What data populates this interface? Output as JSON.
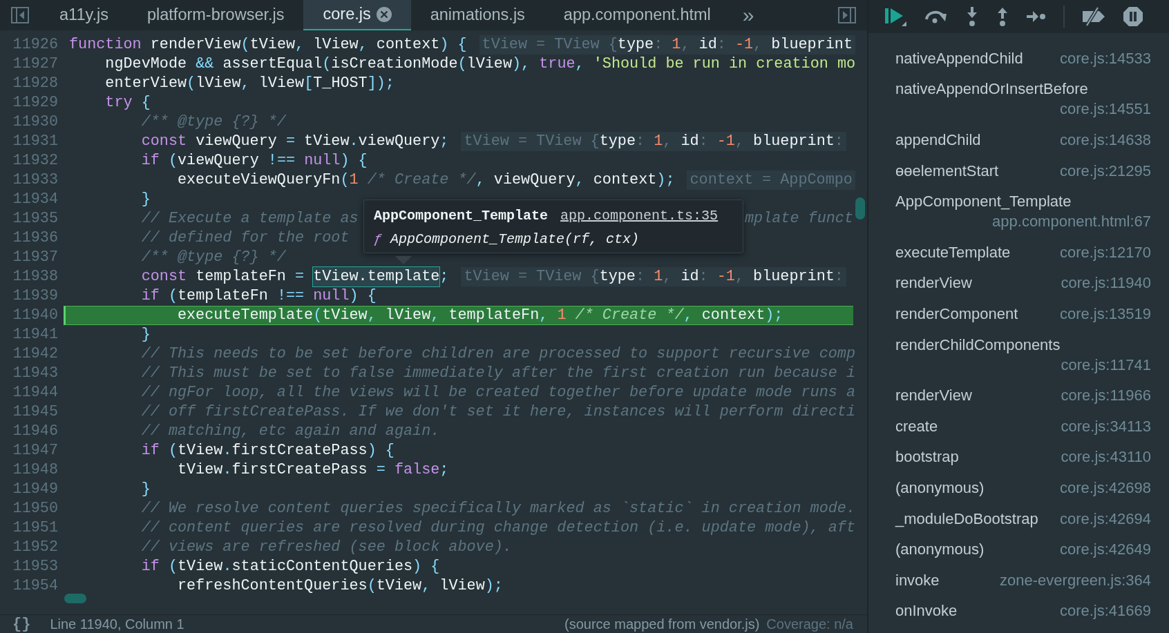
{
  "tabs": [
    {
      "label": "a11y.js",
      "selected": false
    },
    {
      "label": "platform-browser.js",
      "selected": false
    },
    {
      "label": "core.js",
      "selected": true
    },
    {
      "label": "animations.js",
      "selected": false
    },
    {
      "label": "app.component.html",
      "selected": false
    }
  ],
  "more_tabs": "»",
  "lines": [
    {
      "number": "11926",
      "paused": false,
      "tokens": [
        {
          "kind": "k",
          "text": "function "
        },
        {
          "kind": "p",
          "text": "renderView"
        },
        {
          "kind": "o",
          "text": "("
        },
        {
          "kind": "p",
          "text": "tView"
        },
        {
          "kind": "o",
          "text": ", "
        },
        {
          "kind": "p",
          "text": "lView"
        },
        {
          "kind": "o",
          "text": ", "
        },
        {
          "kind": "p",
          "text": "context"
        },
        {
          "kind": "o",
          "text": ") {"
        }
      ],
      "hint": [
        {
          "kind": "h",
          "text": "tView = TView {"
        },
        {
          "kind": "p",
          "text": "type"
        },
        {
          "kind": "h",
          "text": ": "
        },
        {
          "kind": "n",
          "text": "1"
        },
        {
          "kind": "h",
          "text": ", "
        },
        {
          "kind": "p",
          "text": "id"
        },
        {
          "kind": "h",
          "text": ": "
        },
        {
          "kind": "n",
          "text": "-1"
        },
        {
          "kind": "h",
          "text": ", "
        },
        {
          "kind": "p",
          "text": "blueprint"
        }
      ]
    },
    {
      "number": "11927",
      "paused": false,
      "tokens": [
        {
          "kind": "p",
          "text": "    ngDevMode "
        },
        {
          "kind": "o",
          "text": "&& "
        },
        {
          "kind": "p",
          "text": "assertEqual"
        },
        {
          "kind": "o",
          "text": "("
        },
        {
          "kind": "p",
          "text": "isCreationMode"
        },
        {
          "kind": "o",
          "text": "("
        },
        {
          "kind": "p",
          "text": "lView"
        },
        {
          "kind": "o",
          "text": "), "
        },
        {
          "kind": "k",
          "text": "true"
        },
        {
          "kind": "o",
          "text": ", "
        },
        {
          "kind": "s",
          "text": "'Should be run in creation mo"
        }
      ]
    },
    {
      "number": "11928",
      "paused": false,
      "tokens": [
        {
          "kind": "p",
          "text": "    enterView"
        },
        {
          "kind": "o",
          "text": "("
        },
        {
          "kind": "p",
          "text": "lView"
        },
        {
          "kind": "o",
          "text": ", "
        },
        {
          "kind": "p",
          "text": "lView"
        },
        {
          "kind": "o",
          "text": "["
        },
        {
          "kind": "p",
          "text": "T_HOST"
        },
        {
          "kind": "o",
          "text": "]);"
        }
      ]
    },
    {
      "number": "11929",
      "paused": false,
      "tokens": [
        {
          "kind": "k",
          "text": "    try "
        },
        {
          "kind": "o",
          "text": "{"
        }
      ]
    },
    {
      "number": "11930",
      "paused": false,
      "tokens": [
        {
          "kind": "c",
          "text": "        /** @type {?} */"
        }
      ]
    },
    {
      "number": "11931",
      "paused": false,
      "tokens": [
        {
          "kind": "k",
          "text": "        const "
        },
        {
          "kind": "p",
          "text": "viewQuery "
        },
        {
          "kind": "o",
          "text": "= "
        },
        {
          "kind": "p",
          "text": "tView"
        },
        {
          "kind": "o",
          "text": "."
        },
        {
          "kind": "p",
          "text": "viewQuery"
        },
        {
          "kind": "o",
          "text": ";"
        }
      ],
      "hint": [
        {
          "kind": "h",
          "text": "tView = TView {"
        },
        {
          "kind": "p",
          "text": "type"
        },
        {
          "kind": "h",
          "text": ": "
        },
        {
          "kind": "n",
          "text": "1"
        },
        {
          "kind": "h",
          "text": ", "
        },
        {
          "kind": "p",
          "text": "id"
        },
        {
          "kind": "h",
          "text": ": "
        },
        {
          "kind": "n",
          "text": "-1"
        },
        {
          "kind": "h",
          "text": ", "
        },
        {
          "kind": "p",
          "text": "blueprint"
        },
        {
          "kind": "h",
          "text": ":"
        }
      ]
    },
    {
      "number": "11932",
      "paused": false,
      "tokens": [
        {
          "kind": "k",
          "text": "        if "
        },
        {
          "kind": "o",
          "text": "("
        },
        {
          "kind": "p",
          "text": "viewQuery "
        },
        {
          "kind": "o",
          "text": "!== "
        },
        {
          "kind": "k",
          "text": "null"
        },
        {
          "kind": "o",
          "text": ") {"
        }
      ]
    },
    {
      "number": "11933",
      "paused": false,
      "tokens": [
        {
          "kind": "p",
          "text": "            executeViewQueryFn"
        },
        {
          "kind": "o",
          "text": "("
        },
        {
          "kind": "n",
          "text": "1 "
        },
        {
          "kind": "c",
          "text": "/* Create */"
        },
        {
          "kind": "o",
          "text": ", "
        },
        {
          "kind": "p",
          "text": "viewQuery"
        },
        {
          "kind": "o",
          "text": ", "
        },
        {
          "kind": "p",
          "text": "context"
        },
        {
          "kind": "o",
          "text": ");"
        }
      ],
      "hint": [
        {
          "kind": "h",
          "text": "context = AppCompo"
        }
      ]
    },
    {
      "number": "11934",
      "paused": false,
      "tokens": [
        {
          "kind": "o",
          "text": "        }"
        }
      ]
    },
    {
      "number": "11935",
      "paused": false,
      "tokens": [
        {
          "kind": "c",
          "text": "        // Execute a template as"
        },
        {
          "kind": "tail",
          "text": "mplate funct"
        }
      ]
    },
    {
      "number": "11936",
      "paused": false,
      "tokens": [
        {
          "kind": "c",
          "text": "        // defined for the root"
        }
      ]
    },
    {
      "number": "11937",
      "paused": false,
      "tokens": [
        {
          "kind": "c",
          "text": "        /** @type {?} */"
        }
      ]
    },
    {
      "number": "11938",
      "paused": false,
      "tokens": [
        {
          "kind": "k",
          "text": "        const "
        },
        {
          "kind": "p",
          "text": "templateFn "
        },
        {
          "kind": "o",
          "text": "= "
        },
        {
          "kind": "hl",
          "text": "tView.template"
        },
        {
          "kind": "o",
          "text": ";"
        }
      ],
      "hint": [
        {
          "kind": "h",
          "text": "tView = TView {"
        },
        {
          "kind": "p",
          "text": "type"
        },
        {
          "kind": "h",
          "text": ": "
        },
        {
          "kind": "n",
          "text": "1"
        },
        {
          "kind": "h",
          "text": ", "
        },
        {
          "kind": "p",
          "text": "id"
        },
        {
          "kind": "h",
          "text": ": "
        },
        {
          "kind": "n",
          "text": "-1"
        },
        {
          "kind": "h",
          "text": ", "
        },
        {
          "kind": "p",
          "text": "blueprint"
        },
        {
          "kind": "h",
          "text": ":"
        }
      ]
    },
    {
      "number": "11939",
      "paused": false,
      "tokens": [
        {
          "kind": "k",
          "text": "        if "
        },
        {
          "kind": "o",
          "text": "("
        },
        {
          "kind": "p",
          "text": "templateFn "
        },
        {
          "kind": "o",
          "text": "!== "
        },
        {
          "kind": "k",
          "text": "null"
        },
        {
          "kind": "o",
          "text": ") {"
        }
      ]
    },
    {
      "number": "11940",
      "paused": true,
      "tokens": [
        {
          "kind": "p",
          "text": "            executeTemplate"
        },
        {
          "kind": "o",
          "text": "("
        },
        {
          "kind": "p",
          "text": "tView"
        },
        {
          "kind": "o",
          "text": ", "
        },
        {
          "kind": "p",
          "text": "lView"
        },
        {
          "kind": "o",
          "text": ", "
        },
        {
          "kind": "p",
          "text": "templateFn"
        },
        {
          "kind": "o",
          "text": ", "
        },
        {
          "kind": "n",
          "text": "1 "
        },
        {
          "kind": "c",
          "text": "/* Create */"
        },
        {
          "kind": "o",
          "text": ", "
        },
        {
          "kind": "p",
          "text": "context"
        },
        {
          "kind": "o",
          "text": ");"
        }
      ]
    },
    {
      "number": "11941",
      "paused": false,
      "tokens": [
        {
          "kind": "o",
          "text": "        }"
        }
      ]
    },
    {
      "number": "11942",
      "paused": false,
      "tokens": [
        {
          "kind": "c",
          "text": "        // This needs to be set before children are processed to support recursive comp"
        }
      ]
    },
    {
      "number": "11943",
      "paused": false,
      "tokens": [
        {
          "kind": "c",
          "text": "        // This must be set to false immediately after the first creation run because i"
        }
      ]
    },
    {
      "number": "11944",
      "paused": false,
      "tokens": [
        {
          "kind": "c",
          "text": "        // ngFor loop, all the views will be created together before update mode runs a"
        }
      ]
    },
    {
      "number": "11945",
      "paused": false,
      "tokens": [
        {
          "kind": "c",
          "text": "        // off firstCreatePass. If we don't set it here, instances will perform directi"
        }
      ]
    },
    {
      "number": "11946",
      "paused": false,
      "tokens": [
        {
          "kind": "c",
          "text": "        // matching, etc again and again."
        }
      ]
    },
    {
      "number": "11947",
      "paused": false,
      "tokens": [
        {
          "kind": "k",
          "text": "        if "
        },
        {
          "kind": "o",
          "text": "("
        },
        {
          "kind": "p",
          "text": "tView"
        },
        {
          "kind": "o",
          "text": "."
        },
        {
          "kind": "p",
          "text": "firstCreatePass"
        },
        {
          "kind": "o",
          "text": ") {"
        }
      ]
    },
    {
      "number": "11948",
      "paused": false,
      "tokens": [
        {
          "kind": "p",
          "text": "            tView"
        },
        {
          "kind": "o",
          "text": "."
        },
        {
          "kind": "p",
          "text": "firstCreatePass "
        },
        {
          "kind": "o",
          "text": "= "
        },
        {
          "kind": "k",
          "text": "false"
        },
        {
          "kind": "o",
          "text": ";"
        }
      ]
    },
    {
      "number": "11949",
      "paused": false,
      "tokens": [
        {
          "kind": "o",
          "text": "        }"
        }
      ]
    },
    {
      "number": "11950",
      "paused": false,
      "tokens": [
        {
          "kind": "c",
          "text": "        // We resolve content queries specifically marked as `static` in creation mode."
        }
      ]
    },
    {
      "number": "11951",
      "paused": false,
      "tokens": [
        {
          "kind": "c",
          "text": "        // content queries are resolved during change detection (i.e. update mode), aft"
        }
      ]
    },
    {
      "number": "11952",
      "paused": false,
      "tokens": [
        {
          "kind": "c",
          "text": "        // views are refreshed (see block above)."
        }
      ]
    },
    {
      "number": "11953",
      "paused": false,
      "tokens": [
        {
          "kind": "k",
          "text": "        if "
        },
        {
          "kind": "o",
          "text": "("
        },
        {
          "kind": "p",
          "text": "tView"
        },
        {
          "kind": "o",
          "text": "."
        },
        {
          "kind": "p",
          "text": "staticContentQueries"
        },
        {
          "kind": "o",
          "text": ") {"
        }
      ]
    },
    {
      "number": "11954",
      "paused": false,
      "tokens": [
        {
          "kind": "p",
          "text": "            refreshContentQueries"
        },
        {
          "kind": "o",
          "text": "("
        },
        {
          "kind": "p",
          "text": "tView"
        },
        {
          "kind": "o",
          "text": ", "
        },
        {
          "kind": "p",
          "text": "lView"
        },
        {
          "kind": "o",
          "text": ");"
        }
      ]
    }
  ],
  "tooltip": {
    "title": "AppComponent_Template",
    "link": "app.component.ts:35",
    "glyph": "ƒ",
    "signature": "AppComponent_Template(rf, ctx)"
  },
  "status_bar": {
    "pretty_print": "{}",
    "position": "Line 11940, Column 1",
    "source_map": "(source mapped from vendor.js)",
    "coverage": "Coverage: n/a"
  },
  "call_stack": [
    {
      "name": "nativeAppendChild",
      "location": "core.js:14533"
    },
    {
      "name": "nativeAppendOrInsertBefore",
      "location": "core.js:14551"
    },
    {
      "name": "appendChild",
      "location": "core.js:14638"
    },
    {
      "name": "ɵɵelementStart",
      "location": "core.js:21295"
    },
    {
      "name": "AppComponent_Template",
      "location": "app.component.html:67"
    },
    {
      "name": "executeTemplate",
      "location": "core.js:12170"
    },
    {
      "name": "renderView",
      "location": "core.js:11940"
    },
    {
      "name": "renderComponent",
      "location": "core.js:13519"
    },
    {
      "name": "renderChildComponents",
      "location": "core.js:11741"
    },
    {
      "name": "renderView",
      "location": "core.js:11966"
    },
    {
      "name": "create",
      "location": "core.js:34113"
    },
    {
      "name": "bootstrap",
      "location": "core.js:43110"
    },
    {
      "name": "(anonymous)",
      "location": "core.js:42698"
    },
    {
      "name": "_moduleDoBootstrap",
      "location": "core.js:42694"
    },
    {
      "name": "(anonymous)",
      "location": "core.js:42649"
    },
    {
      "name": "invoke",
      "location": "zone-evergreen.js:364"
    },
    {
      "name": "onInvoke",
      "location": "core.js:41669"
    }
  ]
}
